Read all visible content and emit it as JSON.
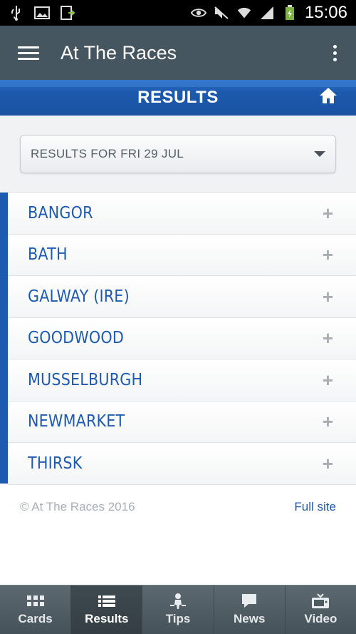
{
  "status_bar": {
    "time": "15:06",
    "icons": [
      "usb-icon",
      "image-icon",
      "download-icon",
      "eye-icon",
      "mute-icon",
      "wifi-icon",
      "signal-icon",
      "battery-charging-icon"
    ]
  },
  "app_bar": {
    "title": "At The Races",
    "menu_icon": "hamburger-menu-icon",
    "overflow_icon": "overflow-menu-icon"
  },
  "section_bar": {
    "title": "RESULTS",
    "home_icon": "home-icon"
  },
  "date_select": {
    "selected": "RESULTS FOR FRI 29 JUL"
  },
  "meetings": [
    {
      "label": "BANGOR"
    },
    {
      "label": "BATH"
    },
    {
      "label": "GALWAY (IRE)"
    },
    {
      "label": "GOODWOOD"
    },
    {
      "label": "MUSSELBURGH"
    },
    {
      "label": "NEWMARKET"
    },
    {
      "label": "THIRSK"
    }
  ],
  "footer": {
    "copyright": "© At The Races 2016",
    "full_site": "Full site"
  },
  "tabs": [
    {
      "label": "Cards",
      "icon": "grid-icon",
      "active": false
    },
    {
      "label": "Results",
      "icon": "list-icon",
      "active": true
    },
    {
      "label": "Tips",
      "icon": "jockey-icon",
      "active": false
    },
    {
      "label": "News",
      "icon": "speech-bubble-icon",
      "active": false
    },
    {
      "label": "Video",
      "icon": "tv-icon",
      "active": false
    }
  ],
  "colors": {
    "app_bar": "#455660",
    "accent_blue": "#1e5bb0",
    "tab_bar": "#4f5b62"
  }
}
